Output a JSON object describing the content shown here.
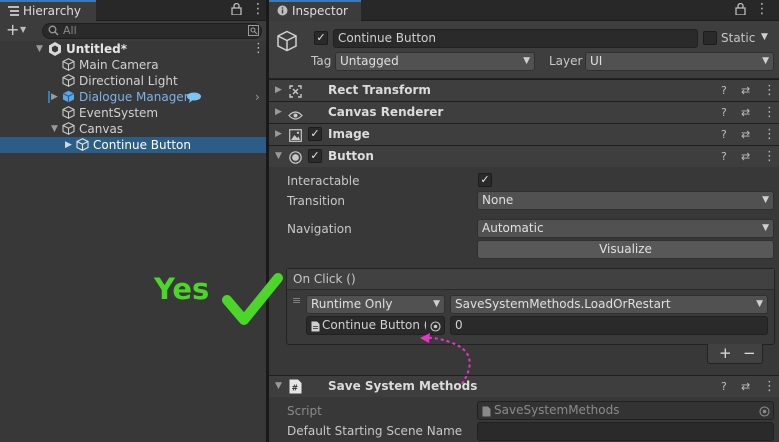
{
  "hierarchy": {
    "tab_label": "Hierarchy",
    "add_label": "+",
    "search_placeholder": "All",
    "scene_name": "Untitled*",
    "items": [
      {
        "label": "Main Camera"
      },
      {
        "label": "Directional Light"
      },
      {
        "label": "Dialogue Manager"
      },
      {
        "label": "EventSystem"
      },
      {
        "label": "Canvas"
      },
      {
        "label": "Continue Button"
      }
    ]
  },
  "inspector": {
    "tab_label": "Inspector",
    "object_name": "Continue Button",
    "static_label": "Static",
    "tag_label": "Tag",
    "tag_value": "Untagged",
    "layer_label": "Layer",
    "layer_value": "UI",
    "components": {
      "rect_transform": "Rect Transform",
      "canvas_renderer": "Canvas Renderer",
      "image": "Image",
      "button": "Button",
      "save_system": "Save System Methods"
    },
    "button_fields": {
      "interactable_label": "Interactable",
      "transition_label": "Transition",
      "transition_value": "None",
      "navigation_label": "Navigation",
      "navigation_value": "Automatic",
      "visualize_label": "Visualize",
      "onclick_label": "On Click ()",
      "runtime_value": "Runtime Only",
      "method_value": "SaveSystemMethods.LoadOrRestart",
      "object_ref": "Continue Button (S",
      "param_value": "0",
      "plus_label": "+",
      "minus_label": "−"
    },
    "save_fields": {
      "script_label": "Script",
      "script_value": "SaveSystemMethods",
      "default_scene_label": "Default Starting Scene Name"
    }
  },
  "annotation": {
    "yes_label": "Yes",
    "colors": {
      "yes_green": "#4cd62a",
      "arrow_magenta": "#e636c8",
      "selection_blue": "#2c5d87",
      "tab_accent": "#3a79bb"
    }
  }
}
